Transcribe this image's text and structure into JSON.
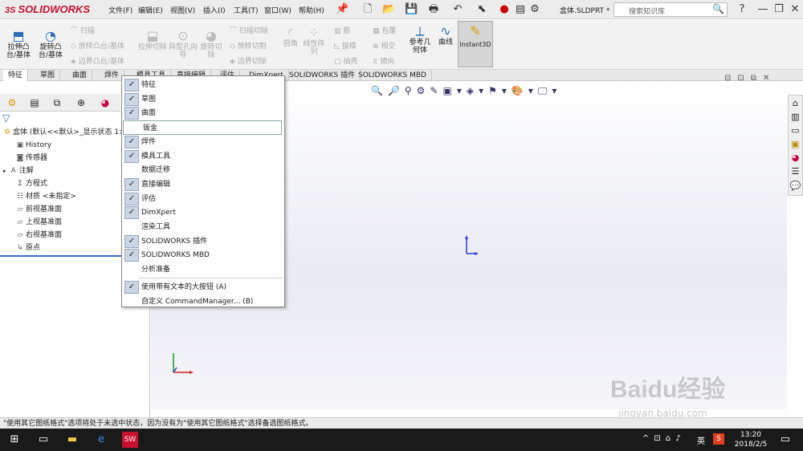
{
  "app": {
    "logo": "SOLIDWORKS",
    "doc_title": "盒体.SLDPRT *",
    "search_placeholder": "搜索知识库"
  },
  "menus": [
    "文件(F)",
    "编辑(E)",
    "视图(V)",
    "插入(I)",
    "工具(T)",
    "窗口(W)",
    "帮助(H)"
  ],
  "ribbon": {
    "extrude_boss": "拉伸凸台/基体",
    "revolve_boss": "旋转凸台/基体",
    "sweep": "扫描",
    "loft": "放样凸台/基体",
    "boundary": "边界凸台/基体",
    "extrude_cut": "拉伸切除",
    "hole_wizard": "异型孔向导",
    "revolve_cut": "旋转切除",
    "sweep_cut": "扫描切除",
    "loft_cut": "放样切割",
    "boundary_cut": "边界切除",
    "fillet": "圆角",
    "linear_pattern": "线性阵列",
    "rib": "筋",
    "draft": "拔模",
    "shell": "抽壳",
    "wrap": "包覆",
    "intersect": "相交",
    "mirror": "镜向",
    "ref_geometry": "参考几何体",
    "curves": "曲线",
    "instant3d": "Instant3D"
  },
  "tabs": [
    "特征",
    "草图",
    "曲面",
    "焊件",
    "模具工具",
    "直接编辑",
    "评估",
    "DimXpert",
    "SOLIDWORKS 插件",
    "SOLIDWORKS MBD"
  ],
  "tree": {
    "root": "盒体 (默认<<默认>_显示状态 1>)",
    "items": [
      "History",
      "传感器",
      "注解",
      "方程式",
      "材质 <未指定>",
      "前视基准面",
      "上视基准面",
      "右视基准面",
      "原点"
    ]
  },
  "context_menu": {
    "items": [
      {
        "label": "特征",
        "checked": true
      },
      {
        "label": "草图",
        "checked": true
      },
      {
        "label": "曲面",
        "checked": true
      },
      {
        "label": "钣金",
        "checked": false
      },
      {
        "label": "焊件",
        "checked": true
      },
      {
        "label": "模具工具",
        "checked": true
      },
      {
        "label": "数据迁移",
        "checked": false
      },
      {
        "label": "直接编辑",
        "checked": true
      },
      {
        "label": "评估",
        "checked": true
      },
      {
        "label": "DimXpert",
        "checked": true
      },
      {
        "label": "渲染工具",
        "checked": false
      },
      {
        "label": "SOLIDWORKS 插件",
        "checked": true
      },
      {
        "label": "SOLIDWORKS MBD",
        "checked": true
      },
      {
        "label": "分析准备",
        "checked": false
      }
    ],
    "large_buttons": "使用带有文本的大按钮 (A)",
    "customize": "自定义 CommandManager... (B)"
  },
  "status": {
    "message": "\"使用其它图纸格式\"选项将处于未选中状态，因为没有为\"使用其它图纸格式\"选择备选图纸格式。"
  },
  "taskbar": {
    "time": "13:20",
    "date": "2018/2/5",
    "ime": "英"
  },
  "watermark": {
    "text": "Baidu经验",
    "url": "jingyan.baidu.com"
  }
}
